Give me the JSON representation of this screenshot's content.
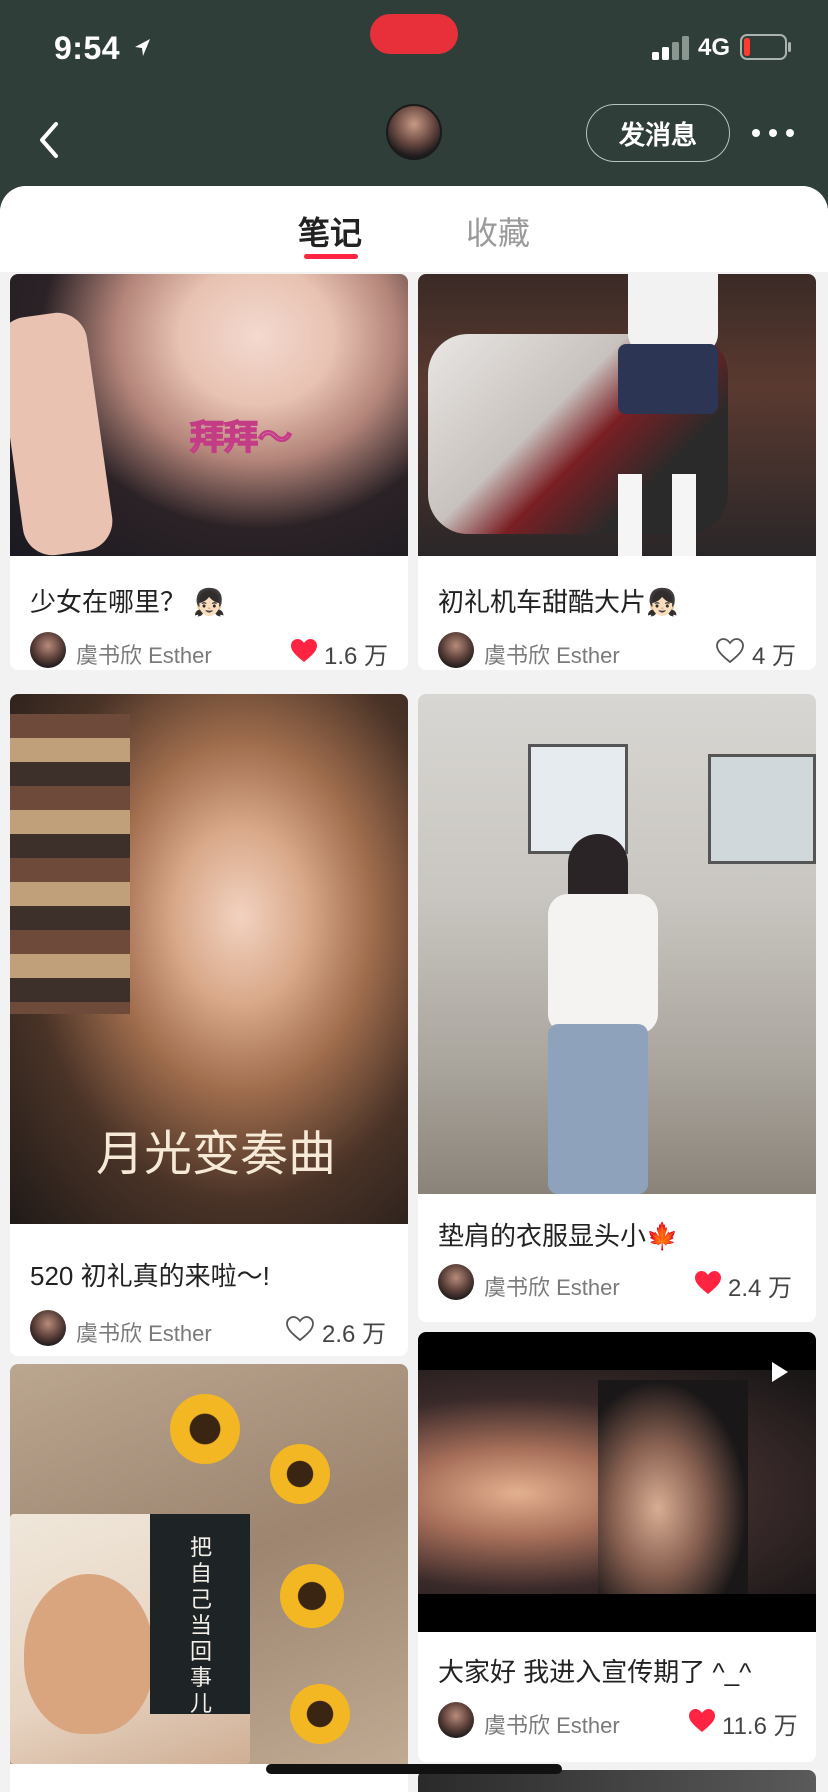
{
  "status_bar": {
    "time": "9:54",
    "network": "4G"
  },
  "header": {
    "message_button_label": "发消息"
  },
  "tabs": [
    {
      "label": "笔记",
      "active": true
    },
    {
      "label": "收藏",
      "active": false
    }
  ],
  "notes": [
    {
      "title": "少女在哪里？ 👧🏻",
      "author": "虞书欣 Esther",
      "likes": "1.6 万",
      "liked": true,
      "overlay_text": "拜拜～"
    },
    {
      "title": "初礼机车甜酷大片👧🏻",
      "author": "虞书欣 Esther",
      "likes": "4 万",
      "liked": false
    },
    {
      "title": "520 初礼真的来啦～!",
      "author": "虞书欣 Esther",
      "likes": "2.6 万",
      "liked": false,
      "overlay_text": "月光变奏曲"
    },
    {
      "title": "垫肩的衣服显头小🍁",
      "author": "虞书欣 Esther",
      "likes": "2.4 万",
      "liked": true
    },
    {
      "title": "",
      "author": "",
      "likes": "",
      "liked": false,
      "overlay_text": "把自己当回事儿"
    },
    {
      "title": "大家好 我进入宣传期了 ^_^",
      "author": "虞书欣 Esther",
      "likes": "11.6 万",
      "liked": true,
      "is_video": true
    }
  ],
  "colors": {
    "accent": "#ff2442",
    "header_bg": "#2f3e39",
    "feed_bg": "#f2f2f2"
  },
  "icons": {
    "back": "chevron-left-icon",
    "more": "ellipsis-icon",
    "like": "heart-icon",
    "play": "play-icon"
  }
}
